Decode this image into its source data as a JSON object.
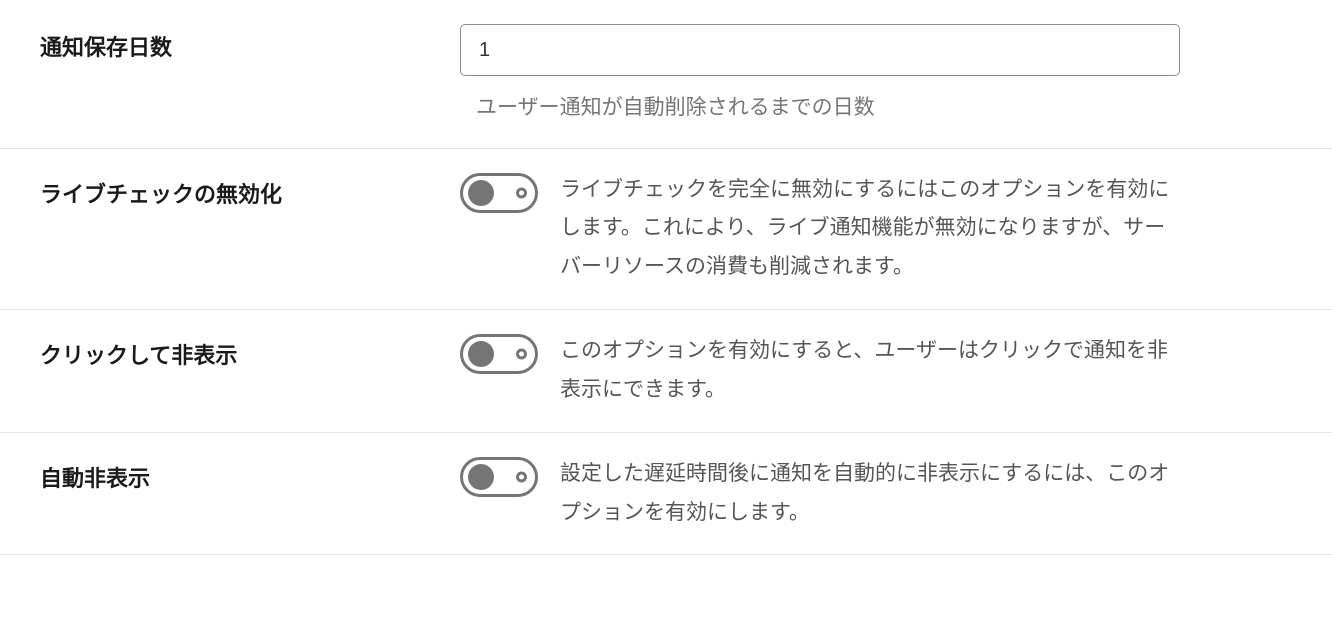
{
  "rows": {
    "retention": {
      "label": "通知保存日数",
      "value": "1",
      "help": "ユーザー通知が自動削除されるまでの日数"
    },
    "disable_live": {
      "label": "ライブチェックの無効化",
      "desc": "ライブチェックを完全に無効にするにはこのオプションを有効にします。これにより、ライブ通知機能が無効になりますが、サーバーリソースの消費も削減されます。"
    },
    "click_hide": {
      "label": "クリックして非表示",
      "desc": "このオプションを有効にすると、ユーザーはクリックで通知を非表示にできます。"
    },
    "auto_hide": {
      "label": "自動非表示",
      "desc": "設定した遅延時間後に通知を自動的に非表示にするには、このオプションを有効にします。"
    }
  }
}
